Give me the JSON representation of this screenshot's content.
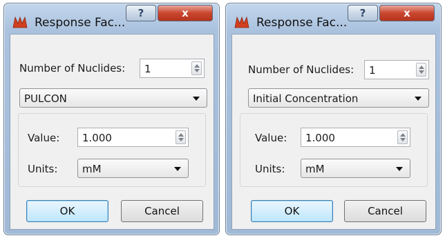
{
  "dialogs": [
    {
      "title": "Response Fac...",
      "nuclides_label": "Number of Nuclides:",
      "nuclides_value": "1",
      "type_selected": "PULCON",
      "value_label": "Value:",
      "value": "1.000",
      "units_label": "Units:",
      "units_selected": "mM",
      "ok_label": "OK",
      "cancel_label": "Cancel",
      "help_glyph": "?",
      "close_glyph": "x"
    },
    {
      "title": "Response Fac...",
      "nuclides_label": "Number of Nuclides:",
      "nuclides_value": "1",
      "type_selected": "Initial Concentration",
      "value_label": "Value:",
      "value": "1.000",
      "units_label": "Units:",
      "units_selected": "mM",
      "ok_label": "OK",
      "cancel_label": "Cancel",
      "help_glyph": "?",
      "close_glyph": "x"
    }
  ],
  "colors": {
    "titlebar": "#aac2de",
    "client": "#f0f0f0",
    "close_button": "#c9462f",
    "ok_accent": "#3c7fb1",
    "app_icon": "#d2401f"
  },
  "icons": {
    "app": "app-logo-icon",
    "help": "help-icon",
    "close": "close-icon"
  }
}
